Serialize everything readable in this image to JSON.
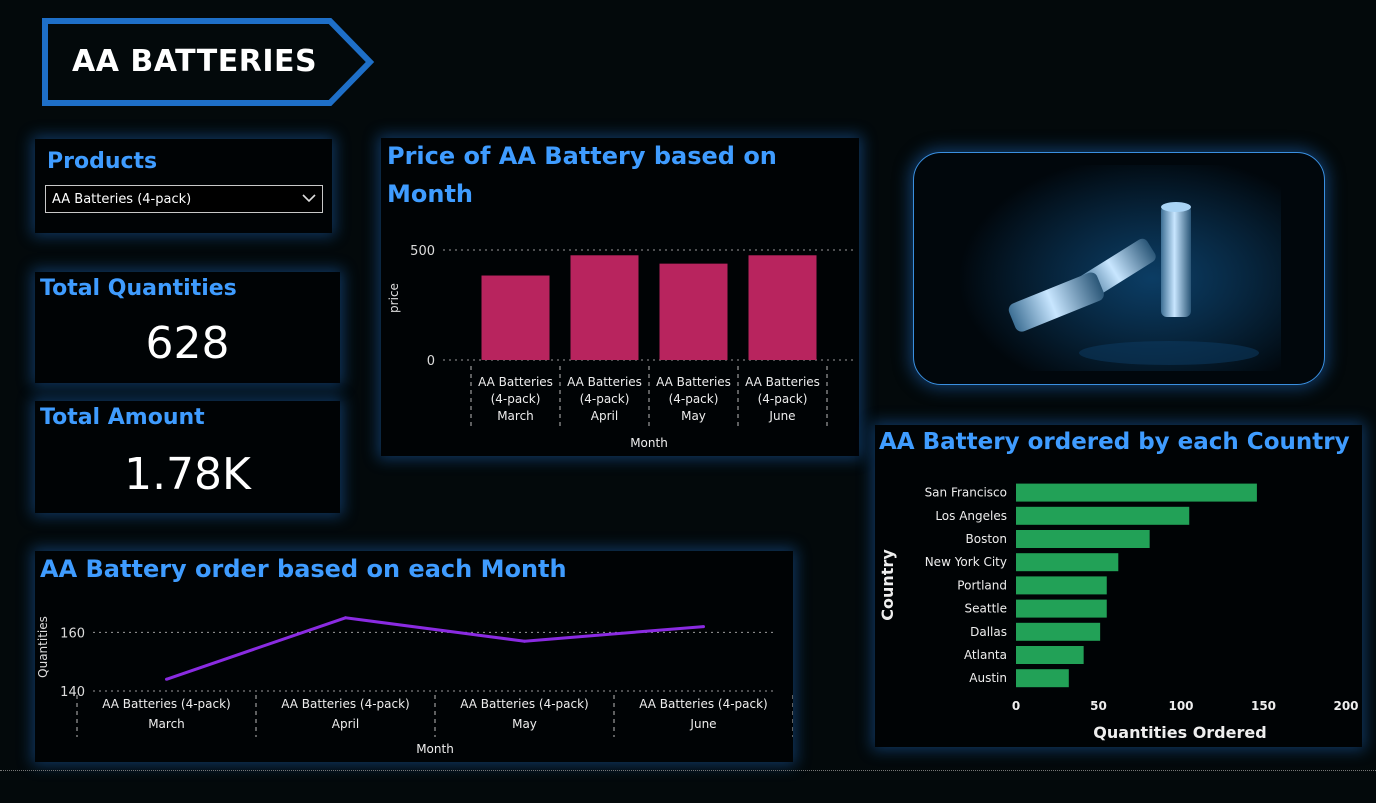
{
  "header": {
    "title": "AA BATTERIES"
  },
  "filter": {
    "title": "Products",
    "selected": "AA Batteries (4-pack)"
  },
  "kpis": {
    "quantities": {
      "label": "Total Quantities",
      "value": "628"
    },
    "amount": {
      "label": "Total Amount",
      "value": "1.78K"
    }
  },
  "colors": {
    "accent": "#3f9cff",
    "bar": "#b8245e",
    "line": "#8a2be2",
    "hbar": "#22a157",
    "border": "#1e6fc8"
  },
  "price_chart": {
    "title_line1": "Price of AA Battery based on",
    "title_line2": "Month"
  },
  "line_chart": {
    "title": "AA Battery order based on each Month"
  },
  "country_chart": {
    "title": "AA Battery ordered by each Country"
  },
  "chart_data": [
    {
      "type": "bar",
      "title": "Price of AA Battery based on Month",
      "xlabel": "Month",
      "ylabel": "price",
      "categories": [
        [
          "AA Batteries",
          "(4-pack)",
          "March"
        ],
        [
          "AA Batteries",
          "(4-pack)",
          "April"
        ],
        [
          "AA Batteries",
          "(4-pack)",
          "May"
        ],
        [
          "AA Batteries",
          "(4-pack)",
          "June"
        ]
      ],
      "values": [
        384,
        476,
        438,
        476
      ],
      "yticks": [
        0,
        500
      ],
      "ylim": [
        0,
        500
      ],
      "grid": true
    },
    {
      "type": "line",
      "title": "AA Battery order based on each Month",
      "xlabel": "Month",
      "ylabel": "Quantities",
      "categories": [
        [
          "AA Batteries (4-pack)",
          "March"
        ],
        [
          "AA Batteries (4-pack)",
          "April"
        ],
        [
          "AA Batteries (4-pack)",
          "May"
        ],
        [
          "AA Batteries (4-pack)",
          "June"
        ]
      ],
      "values": [
        144,
        165,
        157,
        162
      ],
      "yticks": [
        140,
        160
      ],
      "ylim": [
        140,
        168
      ],
      "grid": true
    },
    {
      "type": "bar",
      "orientation": "horizontal",
      "title": "AA Battery ordered by each Country",
      "xlabel": "Quantities Ordered",
      "ylabel": "Country",
      "categories": [
        "San Francisco",
        "Los Angeles",
        "Boston",
        "New York City",
        "Portland",
        "Seattle",
        "Dallas",
        "Atlanta",
        "Austin"
      ],
      "values": [
        146,
        105,
        81,
        62,
        55,
        55,
        51,
        41,
        32
      ],
      "xticks": [
        0,
        50,
        100,
        150,
        200
      ],
      "xlim": [
        0,
        200
      ]
    }
  ]
}
